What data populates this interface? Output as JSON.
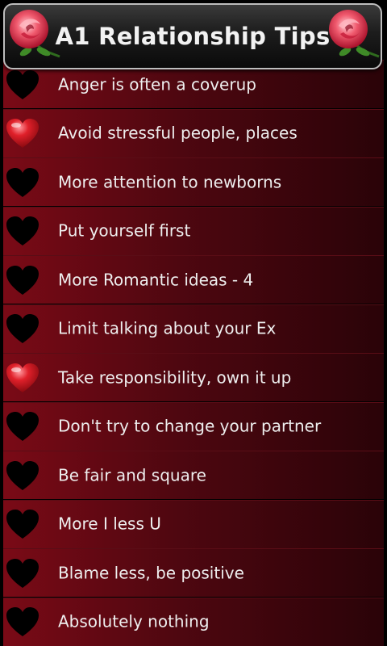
{
  "app": {
    "title": "A1 Relationship Tips"
  },
  "colors": {
    "row_gradient_start": "#7a0a16",
    "row_gradient_end": "#2a0308",
    "heart_favorite": "#e0202a",
    "heart_default": "#000000",
    "rose": "#e8334a"
  },
  "tips": [
    {
      "label": "Anger is often a coverup",
      "favorite": false
    },
    {
      "label": "Avoid stressful people, places",
      "favorite": true
    },
    {
      "label": "More attention to newborns",
      "favorite": false
    },
    {
      "label": "Put yourself first",
      "favorite": false
    },
    {
      "label": "More Romantic ideas - 4",
      "favorite": false
    },
    {
      "label": "Limit talking about your Ex",
      "favorite": false
    },
    {
      "label": "Take responsibility, own it up",
      "favorite": true
    },
    {
      "label": "Don't try to change your partner",
      "favorite": false
    },
    {
      "label": "Be fair and square",
      "favorite": false
    },
    {
      "label": "More I less U",
      "favorite": false
    },
    {
      "label": "Blame less, be positive",
      "favorite": false
    },
    {
      "label": "Absolutely nothing",
      "favorite": false
    }
  ]
}
